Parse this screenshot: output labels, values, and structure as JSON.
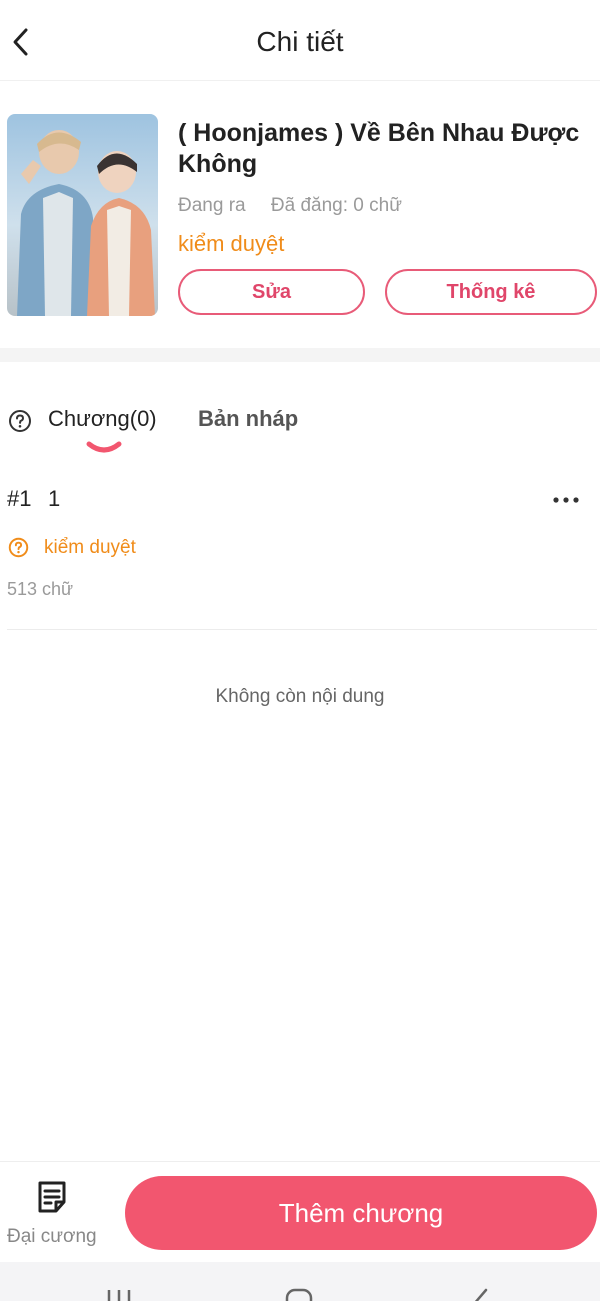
{
  "header": {
    "title": "Chi tiết",
    "back_icon": "chevron-left-icon"
  },
  "book": {
    "title": "( Hoonjames ) Về Bên Nhau Được Không",
    "status": "Đang ra",
    "posted": "Đã đăng: 0 chữ",
    "review_status": "kiểm duyệt",
    "edit_label": "Sửa",
    "stats_label": "Thống kê"
  },
  "tabs": {
    "chapters": "Chương(0)",
    "drafts": "Bản nháp"
  },
  "chapters": [
    {
      "number": "#1",
      "name": "1",
      "status": "kiểm duyệt",
      "words": "513 chữ"
    }
  ],
  "empty_message": "Không còn nội dung",
  "bottom_bar": {
    "outline_label": "Đại cương",
    "add_chapter_label": "Thêm chương"
  },
  "colors": {
    "accent": "#f2566f",
    "warning": "#f08c1a",
    "muted": "#9a9a9a"
  }
}
